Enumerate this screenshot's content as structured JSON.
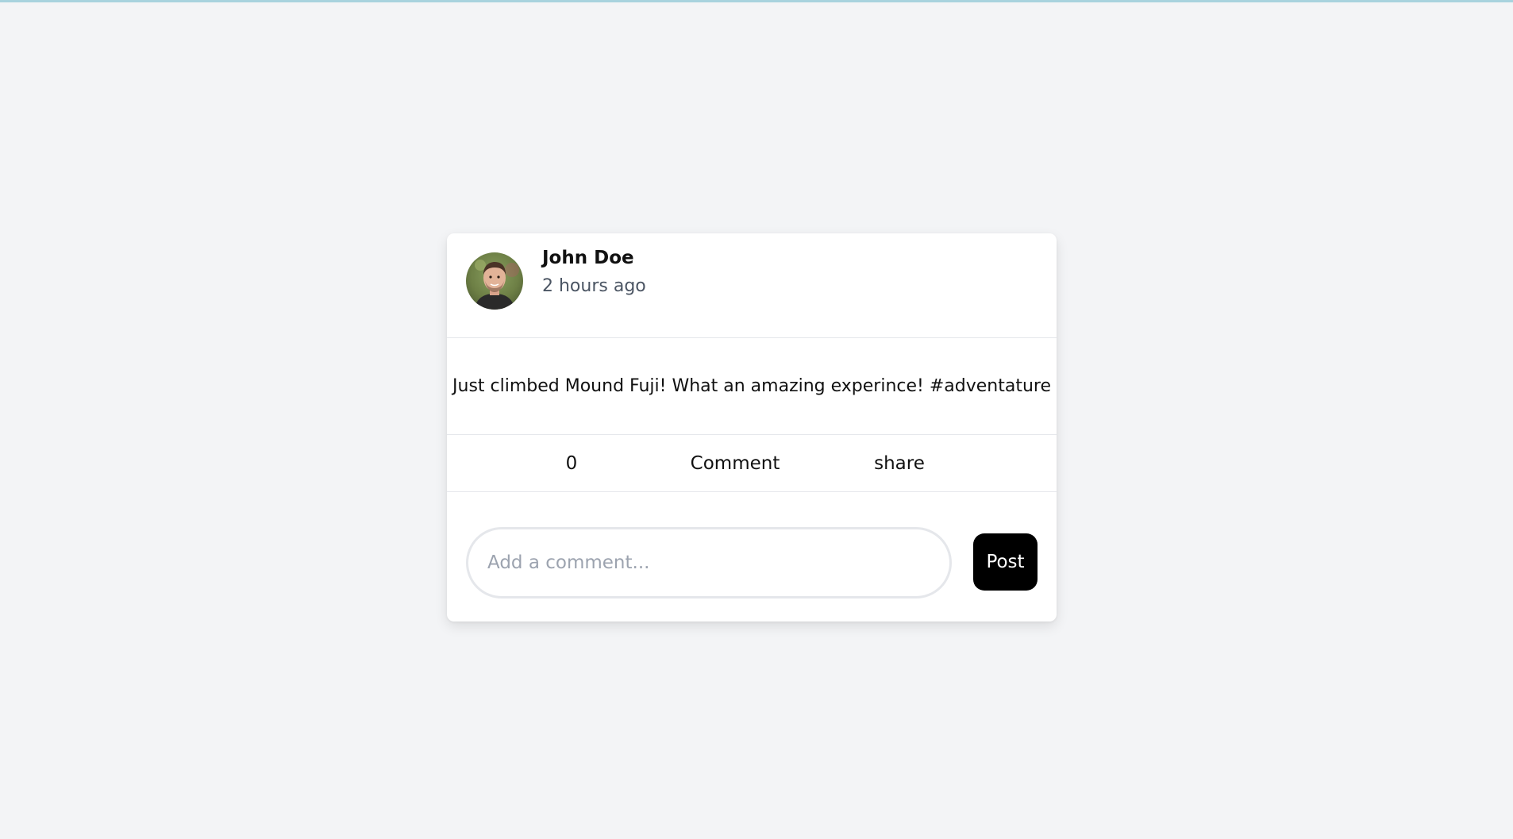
{
  "post": {
    "author_name": "John Doe",
    "timestamp": "2 hours ago",
    "avatar_icon": "profile-photo",
    "content": "Just climbed Mound Fuji! What an amazing experince! #adventature"
  },
  "actions": {
    "like_count": "0",
    "comment_label": "Comment",
    "share_label": "share"
  },
  "comment_form": {
    "placeholder": "Add a comment...",
    "value": "",
    "post_label": "Post"
  },
  "colors": {
    "page_background": "#f3f4f6",
    "card_background": "#ffffff",
    "post_button": "#000000",
    "divider": "#e5e7eb"
  }
}
